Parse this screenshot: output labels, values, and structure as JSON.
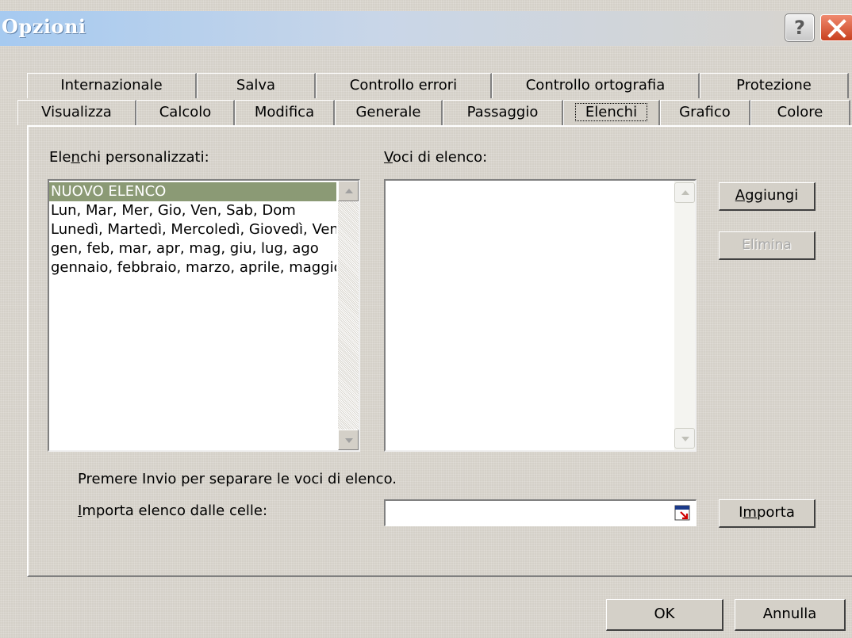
{
  "window": {
    "title": "Opzioni",
    "help_label": "?",
    "close_label": "×"
  },
  "tabs_back": [
    {
      "label": "Internazionale"
    },
    {
      "label": "Salva"
    },
    {
      "label": "Controllo errori"
    },
    {
      "label": "Controllo ortografia"
    },
    {
      "label": "Protezione"
    }
  ],
  "tabs_front": [
    {
      "label": "Visualizza"
    },
    {
      "label": "Calcolo"
    },
    {
      "label": "Modifica"
    },
    {
      "label": "Generale"
    },
    {
      "label": "Passaggio"
    },
    {
      "label": "Elenchi",
      "active": true
    },
    {
      "label": "Grafico"
    },
    {
      "label": "Colore"
    }
  ],
  "custom_lists": {
    "label_pre": "Ele",
    "label_key": "n",
    "label_post": "chi personalizzati:",
    "items": [
      "NUOVO ELENCO",
      "Lun, Mar, Mer, Gio, Ven, Sab, Dom",
      "Lunedì, Martedì, Mercoledì, Giovedì, Venerdì",
      "gen, feb, mar, apr, mag, giu, lug, ago",
      "gennaio, febbraio, marzo, aprile, maggio"
    ],
    "selected_index": 0
  },
  "list_entries": {
    "label_key": "V",
    "label_post": "oci di elenco:",
    "items": []
  },
  "buttons": {
    "add_key": "A",
    "add_post": "ggiungi",
    "delete": "Elimina",
    "import_pre": "I",
    "import_key": "m",
    "import_post": "porta",
    "ok": "OK",
    "cancel": "Annulla"
  },
  "hint": "Premere Invio per separare le voci di elenco.",
  "import_field": {
    "label_key": "I",
    "label_post": "mporta elenco dalle celle:",
    "value": ""
  },
  "icons": {
    "help": "help-icon",
    "close": "close-icon",
    "collapse": "collapse-dialog-icon",
    "scroll_up": "scroll-up-arrow-icon",
    "scroll_down": "scroll-down-arrow-icon"
  },
  "colors": {
    "dialog_bg": "#d4d0c8",
    "selection": "#8b9a75",
    "close_red": "#d8542e",
    "disabled_text": "#a8a8a8"
  }
}
